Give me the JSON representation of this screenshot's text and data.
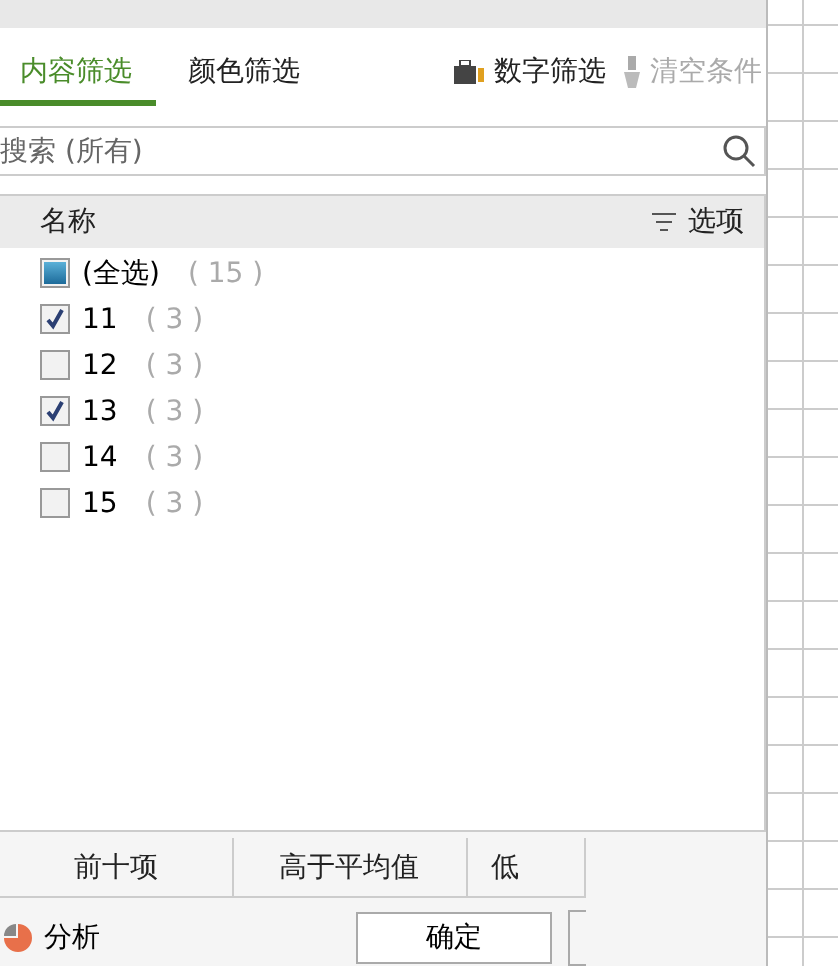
{
  "tabs": [
    {
      "label": "内容筛选",
      "selected": true
    },
    {
      "label": "颜色筛选",
      "selected": false
    }
  ],
  "actions": [
    {
      "label": "数字筛选",
      "disabled": false
    },
    {
      "label": "清空条件",
      "disabled": true
    }
  ],
  "search": {
    "placeholder": "搜索 (所有)"
  },
  "list": {
    "header": "名称",
    "options": "选项",
    "items": [
      {
        "label": "(全选)",
        "count": "( 15 )",
        "partial": true
      },
      {
        "label": "11",
        "count": "( 3 )",
        "checked": true
      },
      {
        "label": "12",
        "count": "( 3 )",
        "checked": false
      },
      {
        "label": "13",
        "count": "( 3 )",
        "checked": true
      },
      {
        "label": "14",
        "count": "( 3 )",
        "checked": false
      },
      {
        "label": "15",
        "count": "( 3 )",
        "checked": false
      }
    ]
  },
  "quick_filters": [
    "前十项",
    "高于平均值",
    "低"
  ],
  "analysis": "分析",
  "ok_button": "确定"
}
